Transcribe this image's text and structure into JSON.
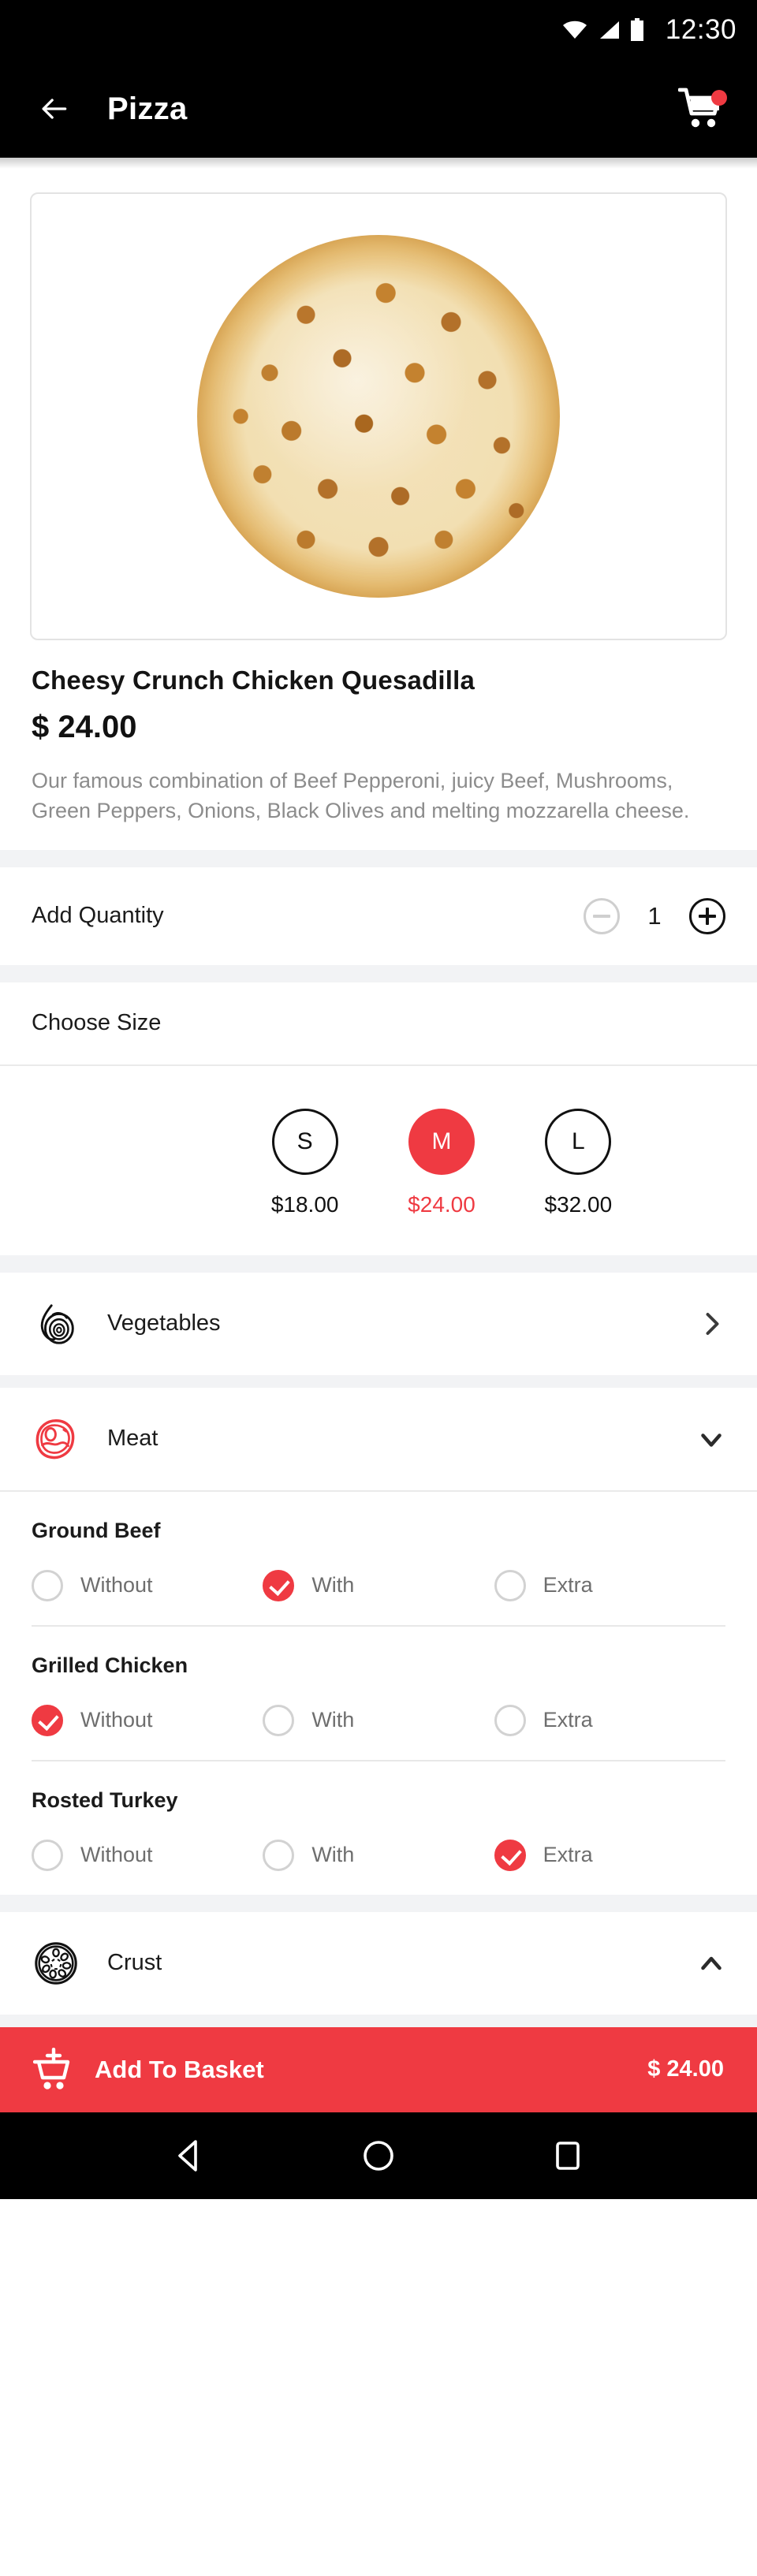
{
  "status_bar": {
    "time": "12:30",
    "icons": [
      "wifi-icon",
      "signal-icon",
      "battery-icon"
    ]
  },
  "app_bar": {
    "back_icon": "back-arrow-icon",
    "title": "Pizza",
    "cart_icon": "shopping-cart-icon",
    "cart_has_badge": true,
    "badge_color": "#EF3A42"
  },
  "product": {
    "image_alt": "cheesy-chicken-pizza-photo",
    "title": "Cheesy Crunch Chicken Quesadilla",
    "price": "$ 24.00",
    "description": "Our famous combination of Beef Pepperoni, juicy Beef, Mushrooms, Green Peppers, Onions, Black Olives and melting mozzarella cheese."
  },
  "quantity": {
    "label": "Add Quantity",
    "value": "1",
    "decrement_enabled": false,
    "increment_enabled": true
  },
  "size": {
    "heading": "Choose Size",
    "options": [
      {
        "code": "S",
        "price": "$18.00",
        "selected": false
      },
      {
        "code": "M",
        "price": "$24.00",
        "selected": true
      },
      {
        "code": "L",
        "price": "$32.00",
        "selected": false
      }
    ]
  },
  "categories": [
    {
      "name": "Vegetables",
      "icon": "onion-icon",
      "icon_color": "#111111",
      "expanded": false,
      "chevron": "chevron-right-icon"
    },
    {
      "name": "Meat",
      "icon": "steak-icon",
      "icon_color": "#EF3A42",
      "expanded": true,
      "chevron": "chevron-down-icon"
    },
    {
      "name": "Crust",
      "icon": "pizza-crust-icon",
      "icon_color": "#111111",
      "expanded": true,
      "chevron": "chevron-up-icon"
    }
  ],
  "meat_options": [
    {
      "title": "Ground Beef",
      "choices": [
        {
          "label": "Without",
          "selected": false
        },
        {
          "label": "With",
          "selected": true
        },
        {
          "label": "Extra",
          "selected": false
        }
      ]
    },
    {
      "title": "Grilled Chicken",
      "choices": [
        {
          "label": "Without",
          "selected": true
        },
        {
          "label": "With",
          "selected": false
        },
        {
          "label": "Extra",
          "selected": false
        }
      ]
    },
    {
      "title": "Rosted Turkey",
      "choices": [
        {
          "label": "Without",
          "selected": false
        },
        {
          "label": "With",
          "selected": false
        },
        {
          "label": "Extra",
          "selected": true
        }
      ]
    }
  ],
  "basket": {
    "icon": "add-to-cart-icon",
    "label": "Add To Basket",
    "total": "$ 24.00",
    "background": "#EF3A42"
  },
  "nav_bar": {
    "back": "android-back-icon",
    "home": "android-home-icon",
    "recents": "android-recents-icon"
  },
  "theme": {
    "accent": "#EF3A42",
    "appbar_bg": "#000000",
    "divider": "#f2f3f5"
  }
}
